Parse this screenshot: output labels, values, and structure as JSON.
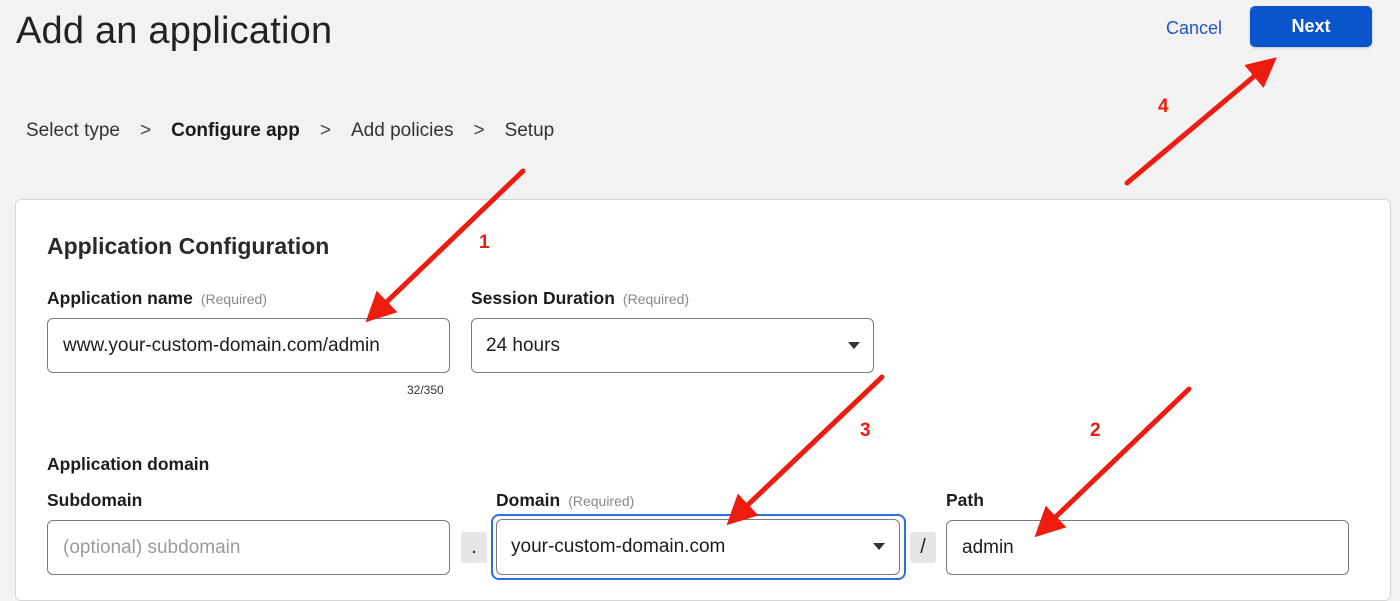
{
  "header": {
    "title": "Add an application",
    "cancel_label": "Cancel",
    "next_label": "Next"
  },
  "steps": [
    "Select type",
    "Configure app",
    "Add policies",
    "Setup"
  ],
  "step_separator": ">",
  "active_step": "Configure app",
  "form": {
    "section_title": "Application Configuration",
    "app_name": {
      "label": "Application name",
      "required": "(Required)",
      "value": "www.your-custom-domain.com/admin",
      "char_count": "32/350"
    },
    "session": {
      "label": "Session Duration",
      "required": "(Required)",
      "value": "24 hours"
    },
    "domain_section_label": "Application domain",
    "subdomain": {
      "label": "Subdomain",
      "placeholder": "(optional) subdomain"
    },
    "dot_separator": ".",
    "domain": {
      "label": "Domain",
      "required": "(Required)",
      "value": "your-custom-domain.com"
    },
    "slash_separator": "/",
    "path": {
      "label": "Path",
      "value": "admin"
    }
  },
  "annotations": {
    "one": "1",
    "two": "2",
    "three": "3",
    "four": "4"
  },
  "colors": {
    "accent": "#0b55cc",
    "annotation": "#ee1b0f",
    "background": "#f2f2f2"
  }
}
